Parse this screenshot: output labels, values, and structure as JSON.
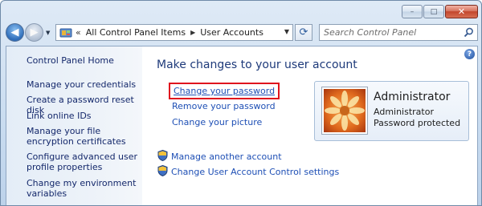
{
  "window": {
    "caption": {
      "minimize": "–",
      "maximize": "□",
      "close": "✕"
    }
  },
  "nav": {
    "back_icon": "back-arrow-icon",
    "forward_icon": "forward-arrow-icon"
  },
  "address": {
    "chevrons": "«",
    "breadcrumb": [
      "All Control Panel Items",
      "User Accounts"
    ],
    "separator": "▶"
  },
  "search": {
    "placeholder": "Search Control Panel"
  },
  "sidebar": {
    "home": "Control Panel Home",
    "items": [
      "Manage your credentials",
      "Create a password reset disk",
      "Link online IDs",
      "Manage your file encryption certificates",
      "Configure advanced user profile properties",
      "Change my environment variables"
    ]
  },
  "main": {
    "title": "Make changes to your user account",
    "tasks": [
      "Change your password",
      "Remove your password",
      "Change your picture"
    ],
    "admin_tasks": [
      "Manage another account",
      "Change User Account Control settings"
    ],
    "help": "?"
  },
  "account": {
    "name": "Administrator",
    "role": "Administrator",
    "status": "Password protected"
  },
  "colors": {
    "link": "#1e4fb5",
    "highlight_box": "#e0141e",
    "title": "#1e3a7a"
  }
}
